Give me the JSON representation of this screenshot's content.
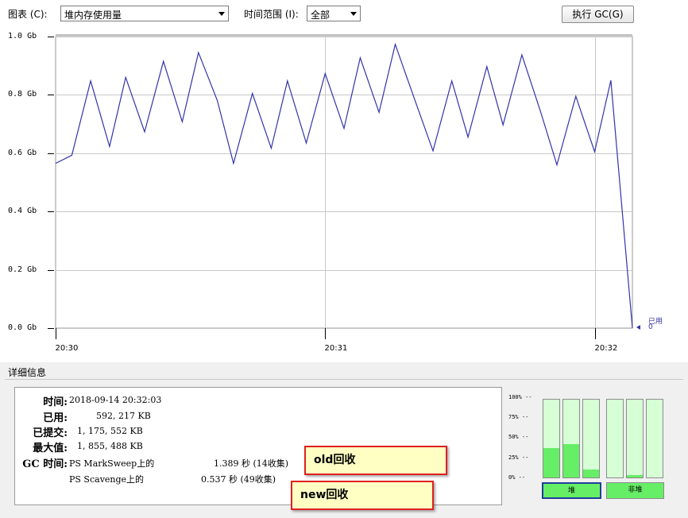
{
  "toolbar": {
    "chart_label": "图表 (C):",
    "chart_value": "堆内存使用量",
    "range_label": "时间范围 (I):",
    "range_value": "全部",
    "gc_button": "执行 GC(G)"
  },
  "chart_data": {
    "type": "line",
    "y_unit": "Gb",
    "ylim": [
      0.0,
      1.0
    ],
    "y_ticks": [
      "1.0 Gb",
      "0.8 Gb",
      "0.6 Gb",
      "0.4 Gb",
      "0.2 Gb",
      "0.0 Gb"
    ],
    "x_ticks": [
      "20:30",
      "20:31",
      "20:32"
    ],
    "x_tick_minutes": [
      0,
      1,
      2
    ],
    "x_range_minutes": [
      0,
      2.14
    ],
    "grid": true,
    "series": [
      {
        "name": "已用",
        "color": "#3333aa",
        "last_value": "0",
        "x": [
          0.0,
          0.06,
          0.13,
          0.2,
          0.26,
          0.33,
          0.4,
          0.47,
          0.53,
          0.6,
          0.66,
          0.73,
          0.8,
          0.86,
          0.93,
          1.0,
          1.07,
          1.13,
          1.2,
          1.26,
          1.33,
          1.4,
          1.47,
          1.53,
          1.6,
          1.66,
          1.73,
          1.8,
          1.86,
          1.93,
          2.0,
          2.06,
          2.14
        ],
        "y": [
          0.565,
          0.593,
          0.848,
          0.623,
          0.86,
          0.673,
          0.915,
          0.708,
          0.945,
          0.78,
          0.565,
          0.805,
          0.617,
          0.848,
          0.635,
          0.873,
          0.685,
          0.927,
          0.74,
          0.973,
          0.79,
          0.608,
          0.848,
          0.655,
          0.897,
          0.697,
          0.937,
          0.74,
          0.56,
          0.795,
          0.605,
          0.85,
          0.0
        ]
      }
    ]
  },
  "details": {
    "section_title": "详细信息",
    "time_label": "时间:",
    "time_value": "2018-09-14 20:32:03",
    "used_label": "已用:",
    "used_value": "592, 217 KB",
    "committed_label": "已提交:",
    "committed_value": "1, 175, 552 KB",
    "max_label": "最大值:",
    "max_value": "1, 855, 488 KB",
    "gc_label": "GC 时间:",
    "gc_rows": [
      {
        "name": "PS MarkSweep上的",
        "value": "1.389 秒 (14收集)"
      },
      {
        "name": "PS Scavenge上的",
        "value": "0.537 秒 (49收集)"
      }
    ]
  },
  "annotations": {
    "old": "old回收",
    "new": "new回收"
  },
  "memory_bars": {
    "ticks": [
      "100% --",
      "75% --",
      "50% --",
      "25% --",
      "0% --"
    ],
    "heap_fills": [
      0.38,
      0.43,
      0.1
    ],
    "nonheap_fills": [
      0.0,
      0.03,
      0.0
    ],
    "heap_button": "堆",
    "nonheap_button": "非堆"
  }
}
